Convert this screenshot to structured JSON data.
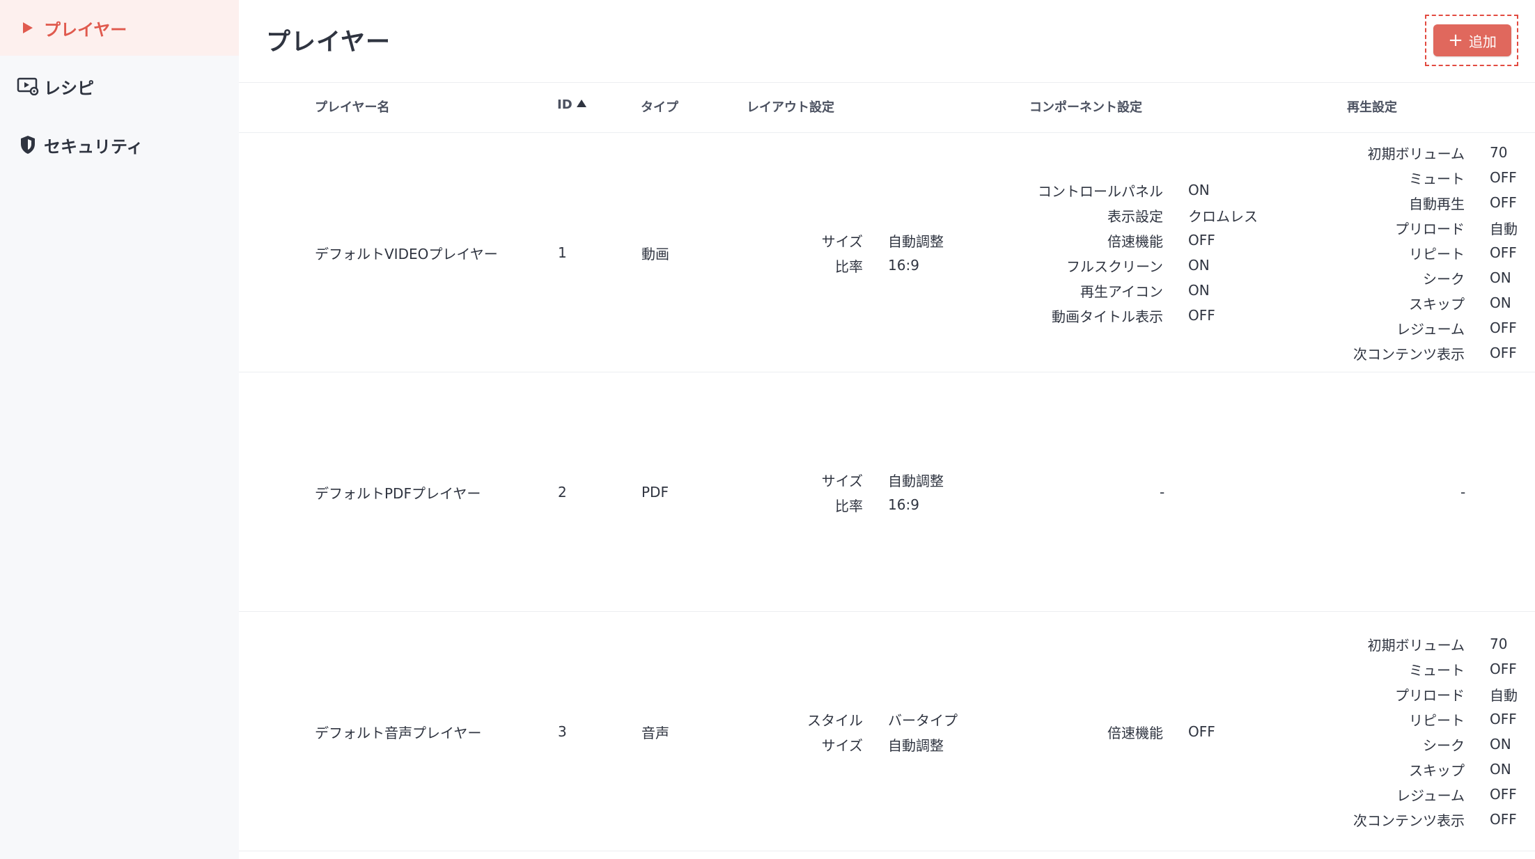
{
  "sidebar": {
    "items": [
      {
        "label": "プレイヤー",
        "icon": "play-icon",
        "active": true
      },
      {
        "label": "レシピ",
        "icon": "recipe-icon",
        "active": false
      },
      {
        "label": "セキュリティ",
        "icon": "shield-icon",
        "active": false
      }
    ]
  },
  "header": {
    "title": "プレイヤー",
    "add_label": "追加"
  },
  "table": {
    "columns": [
      "プレイヤー名",
      "ID",
      "タイプ",
      "レイアウト設定",
      "コンポーネント設定",
      "再生設定"
    ],
    "rows": [
      {
        "name": "デフォルトVIDEOプレイヤー",
        "id": "1",
        "type": "動画",
        "layout": [
          {
            "k": "サイズ",
            "v": "自動調整"
          },
          {
            "k": "比率",
            "v": "16:9"
          }
        ],
        "component": [
          {
            "k": "コントロールパネル",
            "v": "ON"
          },
          {
            "k": "表示設定",
            "v": "クロムレス"
          },
          {
            "k": "倍速機能",
            "v": "OFF"
          },
          {
            "k": "フルスクリーン",
            "v": "ON"
          },
          {
            "k": "再生アイコン",
            "v": "ON"
          },
          {
            "k": "動画タイトル表示",
            "v": "OFF"
          }
        ],
        "playback": [
          {
            "k": "初期ボリューム",
            "v": "70"
          },
          {
            "k": "ミュート",
            "v": "OFF"
          },
          {
            "k": "自動再生",
            "v": "OFF"
          },
          {
            "k": "プリロード",
            "v": "自動"
          },
          {
            "k": "リピート",
            "v": "OFF"
          },
          {
            "k": "シーク",
            "v": "ON"
          },
          {
            "k": "スキップ",
            "v": "ON"
          },
          {
            "k": "レジューム",
            "v": "OFF"
          },
          {
            "k": "次コンテンツ表示",
            "v": "OFF"
          }
        ]
      },
      {
        "name": "デフォルトPDFプレイヤー",
        "id": "2",
        "type": "PDF",
        "layout": [
          {
            "k": "サイズ",
            "v": "自動調整"
          },
          {
            "k": "比率",
            "v": "16:9"
          }
        ],
        "component_empty": "-",
        "playback_empty": "-"
      },
      {
        "name": "デフォルト音声プレイヤー",
        "id": "3",
        "type": "音声",
        "layout": [
          {
            "k": "スタイル",
            "v": "バータイプ"
          },
          {
            "k": "サイズ",
            "v": "自動調整"
          }
        ],
        "component": [
          {
            "k": "倍速機能",
            "v": "OFF"
          }
        ],
        "playback": [
          {
            "k": "初期ボリューム",
            "v": "70"
          },
          {
            "k": "ミュート",
            "v": "OFF"
          },
          {
            "k": "プリロード",
            "v": "自動"
          },
          {
            "k": "リピート",
            "v": "OFF"
          },
          {
            "k": "シーク",
            "v": "ON"
          },
          {
            "k": "スキップ",
            "v": "ON"
          },
          {
            "k": "レジューム",
            "v": "OFF"
          },
          {
            "k": "次コンテンツ表示",
            "v": "OFF"
          }
        ]
      }
    ]
  },
  "colors": {
    "accent": "#e05a4e",
    "button": "#e0685d",
    "sidebar_bg": "#f7f8fa",
    "active_bg": "#fdf0ee"
  }
}
